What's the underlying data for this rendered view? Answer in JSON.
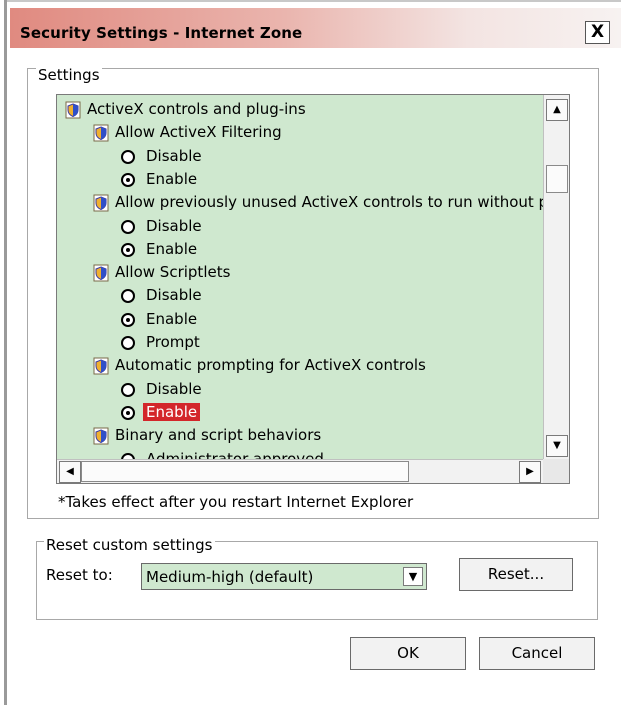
{
  "window": {
    "title": "Security Settings - Internet Zone",
    "close_label": "X"
  },
  "settings": {
    "group_label": "Settings",
    "items": [
      {
        "type": "category",
        "label": "ActiveX controls and plug-ins"
      },
      {
        "type": "setting",
        "label": "Allow ActiveX Filtering"
      },
      {
        "type": "option",
        "label": "Disable",
        "checked": false
      },
      {
        "type": "option",
        "label": "Enable",
        "checked": true
      },
      {
        "type": "setting",
        "label": "Allow previously unused ActiveX controls to run without prom"
      },
      {
        "type": "option",
        "label": "Disable",
        "checked": false
      },
      {
        "type": "option",
        "label": "Enable",
        "checked": true
      },
      {
        "type": "setting",
        "label": "Allow Scriptlets"
      },
      {
        "type": "option",
        "label": "Disable",
        "checked": false
      },
      {
        "type": "option",
        "label": "Enable",
        "checked": true
      },
      {
        "type": "option",
        "label": "Prompt",
        "checked": false
      },
      {
        "type": "setting",
        "label": "Automatic prompting for ActiveX controls"
      },
      {
        "type": "option",
        "label": "Disable",
        "checked": false
      },
      {
        "type": "option",
        "label": "Enable",
        "checked": true,
        "highlighted": true
      },
      {
        "type": "setting",
        "label": "Binary and script behaviors"
      },
      {
        "type": "option",
        "label": "Administrator approved",
        "checked": false
      }
    ],
    "note": "*Takes effect after you restart Internet Explorer"
  },
  "reset": {
    "group_label": "Reset custom settings",
    "reset_to_label": "Reset to:",
    "selected_level": "Medium-high (default)",
    "reset_button": "Reset..."
  },
  "footer": {
    "ok_label": "OK",
    "cancel_label": "Cancel"
  },
  "colors": {
    "list_background": "#cfe8cf",
    "highlight": "#d3262a",
    "title_gradient_start": "#e08a80"
  },
  "icons": {
    "setting_icon": "shield-icon",
    "scroll_up": "arrow-up-icon",
    "scroll_down": "arrow-down-icon",
    "scroll_left": "arrow-left-icon",
    "scroll_right": "arrow-right-icon",
    "dropdown": "chevron-down-icon"
  }
}
